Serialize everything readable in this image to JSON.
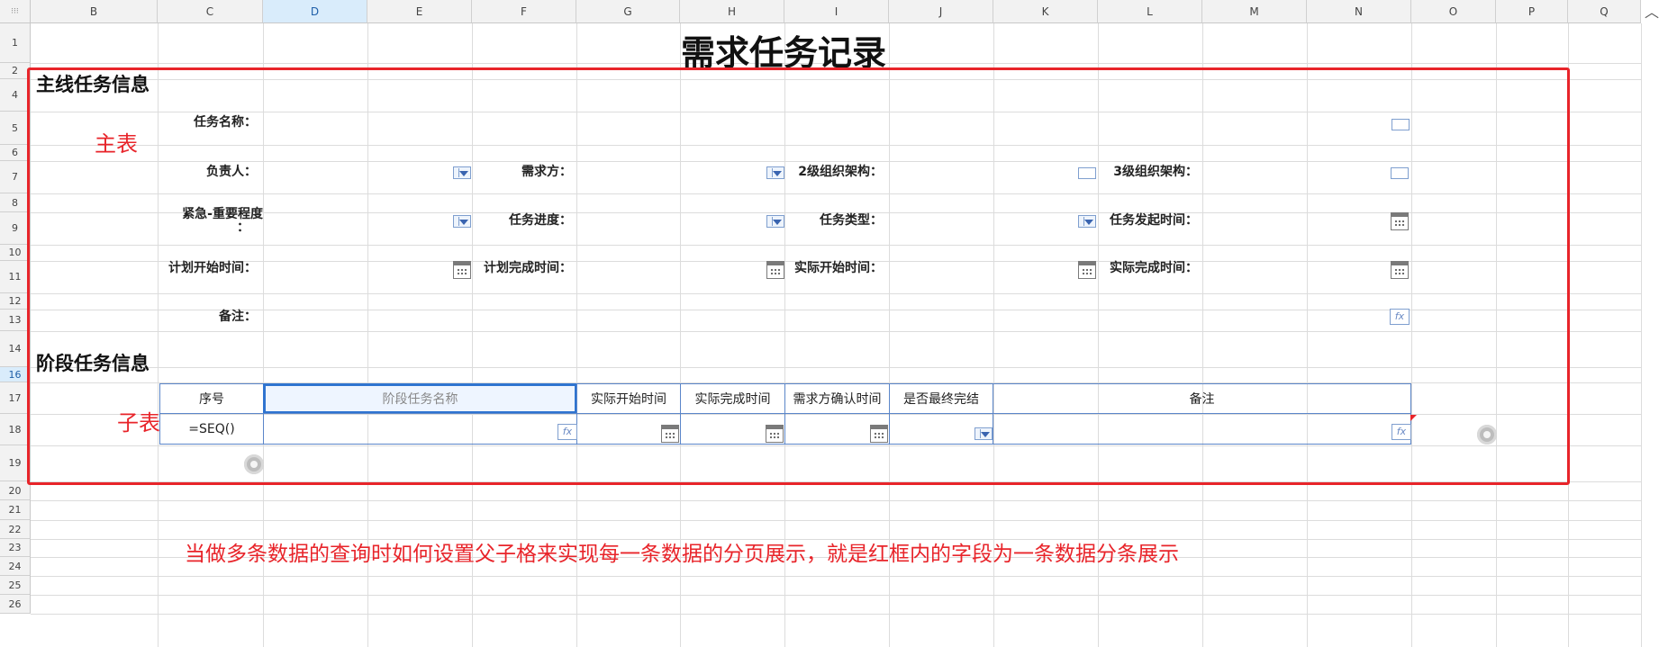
{
  "sheet": {
    "columns": [
      "B",
      "C",
      "D",
      "E",
      "F",
      "G",
      "H",
      "I",
      "J",
      "K",
      "L",
      "M",
      "N",
      "O",
      "P",
      "Q"
    ],
    "selected_column": "D",
    "rows": [
      "1",
      "2",
      "4",
      "5",
      "6",
      "7",
      "8",
      "9",
      "10",
      "11",
      "12",
      "13",
      "14",
      "16",
      "17",
      "18",
      "19",
      "20",
      "21",
      "22",
      "23",
      "24",
      "25",
      "26"
    ],
    "selected_row": "16"
  },
  "report": {
    "title": "需求任务记录",
    "section_main": "主线任务信息",
    "section_stage": "阶段任务信息",
    "annotation_main": "主表",
    "annotation_sub": "子表",
    "question": "当做多条数据的查询时如何设置父子格来实现每一条数据的分页展示，就是红框内的字段为一条数据分条展示",
    "accent_red": "#e8242a",
    "accent_blue": "#2f74d0"
  },
  "fields": {
    "task_name": "任务名称：",
    "owner": "负责人：",
    "requester": "需求方：",
    "org_level2": "2级组织架构：",
    "org_level3": "3级组织架构：",
    "urgency_line1": "紧急-重要程度",
    "urgency_line2": "：",
    "progress": "任务进度：",
    "task_type": "任务类型：",
    "start_time": "任务发起时间：",
    "plan_start": "计划开始时间：",
    "plan_finish": "计划完成时间：",
    "actual_start": "实际开始时间：",
    "actual_finish": "实际完成时间：",
    "remark": "备注："
  },
  "stage_table": {
    "headers": [
      "序号",
      "阶段任务名称",
      "实际开始时间",
      "实际完成时间",
      "需求方确认时间",
      "是否最终完结",
      "备注"
    ],
    "seq_formula": "=SEQ()",
    "fx_label": "fx"
  }
}
